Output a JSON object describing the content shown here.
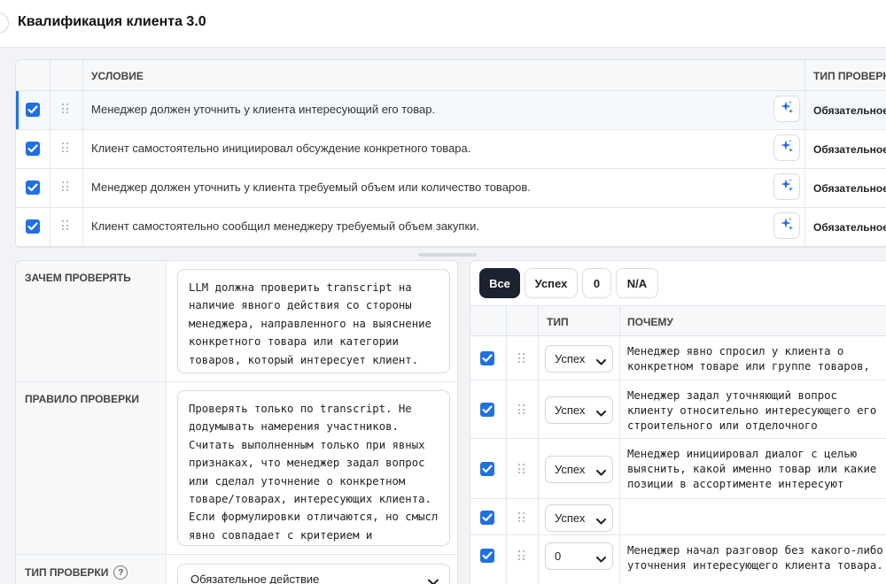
{
  "header": {
    "title": "Квалификация клиента 3.0"
  },
  "conditions": {
    "col_condition": "УСЛОВИЕ",
    "col_type": "ТИП ПРОВЕРКИ",
    "rows": [
      {
        "checked": true,
        "text": "Менеджер должен уточнить у клиента интересующий его товар.",
        "type": "Обязательное действие"
      },
      {
        "checked": true,
        "text": "Клиент самостоятельно инициировал обсуждение конкретного товара.",
        "type": "Обязательное действие"
      },
      {
        "checked": true,
        "text": "Менеджер должен уточнить у клиента требуемый объем или количество товаров.",
        "type": "Обязательное действие"
      },
      {
        "checked": true,
        "text": "Клиент самостоятельно сообщил менеджеру требуемый объем закупки.",
        "type": "Обязательное действие"
      }
    ]
  },
  "details": {
    "why_label": "ЗАЧЕМ ПРОВЕРЯТЬ",
    "why_text": "LLM должна проверить transcript на наличие явного действия со стороны менеджера, направленного на выяснение конкретного товара или категории товаров, который интересует клиент. Это важно для понимания того, насколько",
    "rule_label": "ПРАВИЛО ПРОВЕРКИ",
    "rule_text": "Проверять только по transcript. Не додумывать намерения участников. Считать выполненным только при явных признаках, что менеджер задал вопрос или сделал уточнение о конкретном товаре/товарах, интересующих клиента. Если формулировки отличаются, но смысл явно совпадает с критерием и контекстом компании, критерий нужно считать",
    "type_label": "ТИП ПРОВЕРКИ",
    "type_help": "?",
    "type_value": "Обязательное действие"
  },
  "results": {
    "filters": [
      "Все",
      "Успех",
      "0",
      "N/A"
    ],
    "active_filter": "Все",
    "col_type": "ТИП",
    "col_why": "ПОЧЕМУ",
    "rows": [
      {
        "checked": true,
        "type": "Успех",
        "why": "Менеджер явно спросил у клиента о конкретном товаре или группе товаров,"
      },
      {
        "checked": true,
        "type": "Успех",
        "why": "Менеджер задал уточняющий вопрос клиенту относительно интересующего его строительного или отделочного"
      },
      {
        "checked": true,
        "type": "Успех",
        "why": "Менеджер инициировал диалог с целью выяснить, какой именно товар или какие позиции в ассортименте интересуют"
      },
      {
        "checked": true,
        "type": "Успех",
        "why": ""
      },
      {
        "checked": true,
        "type": "0",
        "why": "Менеджер начал разговор без какого-либо уточнения интересующего клиента товара."
      }
    ]
  },
  "icons": {
    "checkbox": "checkbox-icon",
    "drag": "drag-handle-icon",
    "ai": "sparkle-icon",
    "chevron": "chevron-down-icon"
  },
  "colors": {
    "accent": "#1f6fe5",
    "active_filter_bg": "#1c2230"
  }
}
